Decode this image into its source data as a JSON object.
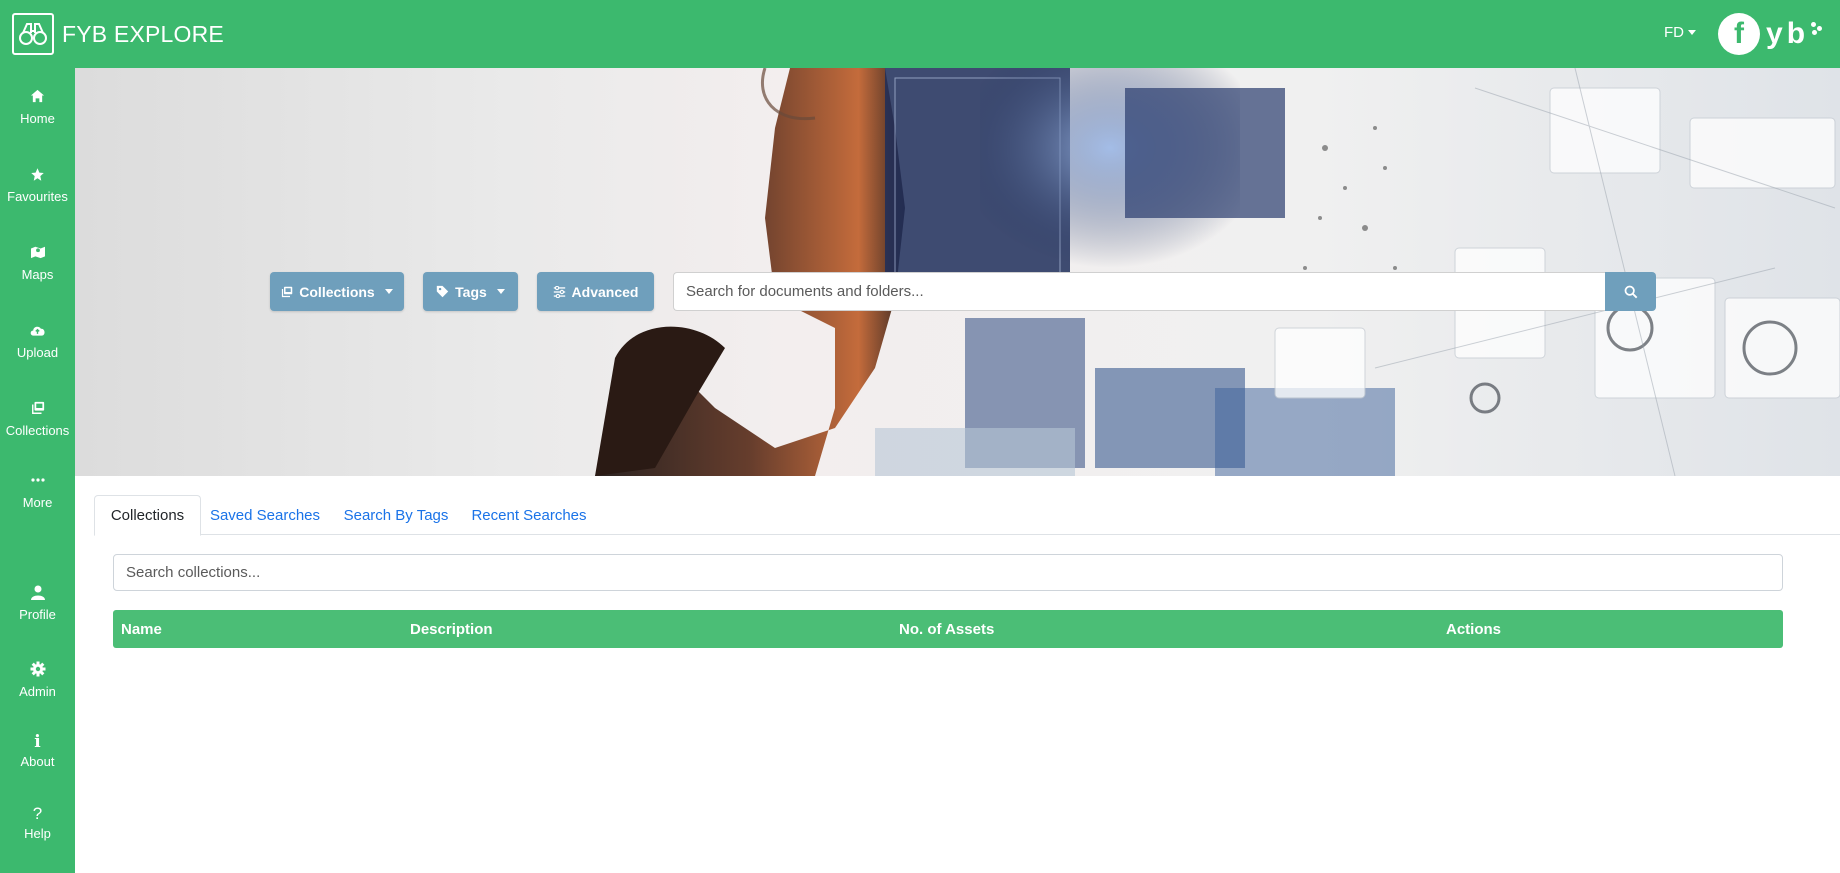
{
  "app": {
    "title": "FYB EXPLORE",
    "user_initials": "FD",
    "partner_logo": {
      "circle": "f",
      "letters": [
        "y",
        "b"
      ]
    }
  },
  "colors": {
    "brand_green": "#3cb96e",
    "table_header_green": "#4bbe76",
    "button_blue": "#6f9fbc",
    "link_blue": "#1a73e8"
  },
  "sidebar": {
    "items": [
      {
        "label": "Home",
        "icon": "home-icon"
      },
      {
        "label": "Favourites",
        "icon": "star-icon"
      },
      {
        "label": "Maps",
        "icon": "map-icon"
      },
      {
        "label": "Upload",
        "icon": "cloud-upload-icon"
      },
      {
        "label": "Collections",
        "icon": "collections-icon"
      },
      {
        "label": "More",
        "icon": "ellipsis-icon"
      },
      {
        "label": "Profile",
        "icon": "user-icon"
      },
      {
        "label": "Admin",
        "icon": "gear-icon"
      },
      {
        "label": "About",
        "icon": "info-icon"
      },
      {
        "label": "Help",
        "icon": "question-icon"
      }
    ]
  },
  "hero": {
    "collections_button": "Collections",
    "tags_button": "Tags",
    "advanced_button": "Advanced",
    "search_placeholder": "Search for documents and folders..."
  },
  "tabs": [
    {
      "label": "Collections",
      "active": true
    },
    {
      "label": "Saved Searches",
      "active": false
    },
    {
      "label": "Search By Tags",
      "active": false
    },
    {
      "label": "Recent Searches",
      "active": false
    }
  ],
  "collections": {
    "search_placeholder": "Search collections...",
    "columns": [
      "Name",
      "Description",
      "No. of Assets",
      "Actions"
    ],
    "rows": []
  }
}
